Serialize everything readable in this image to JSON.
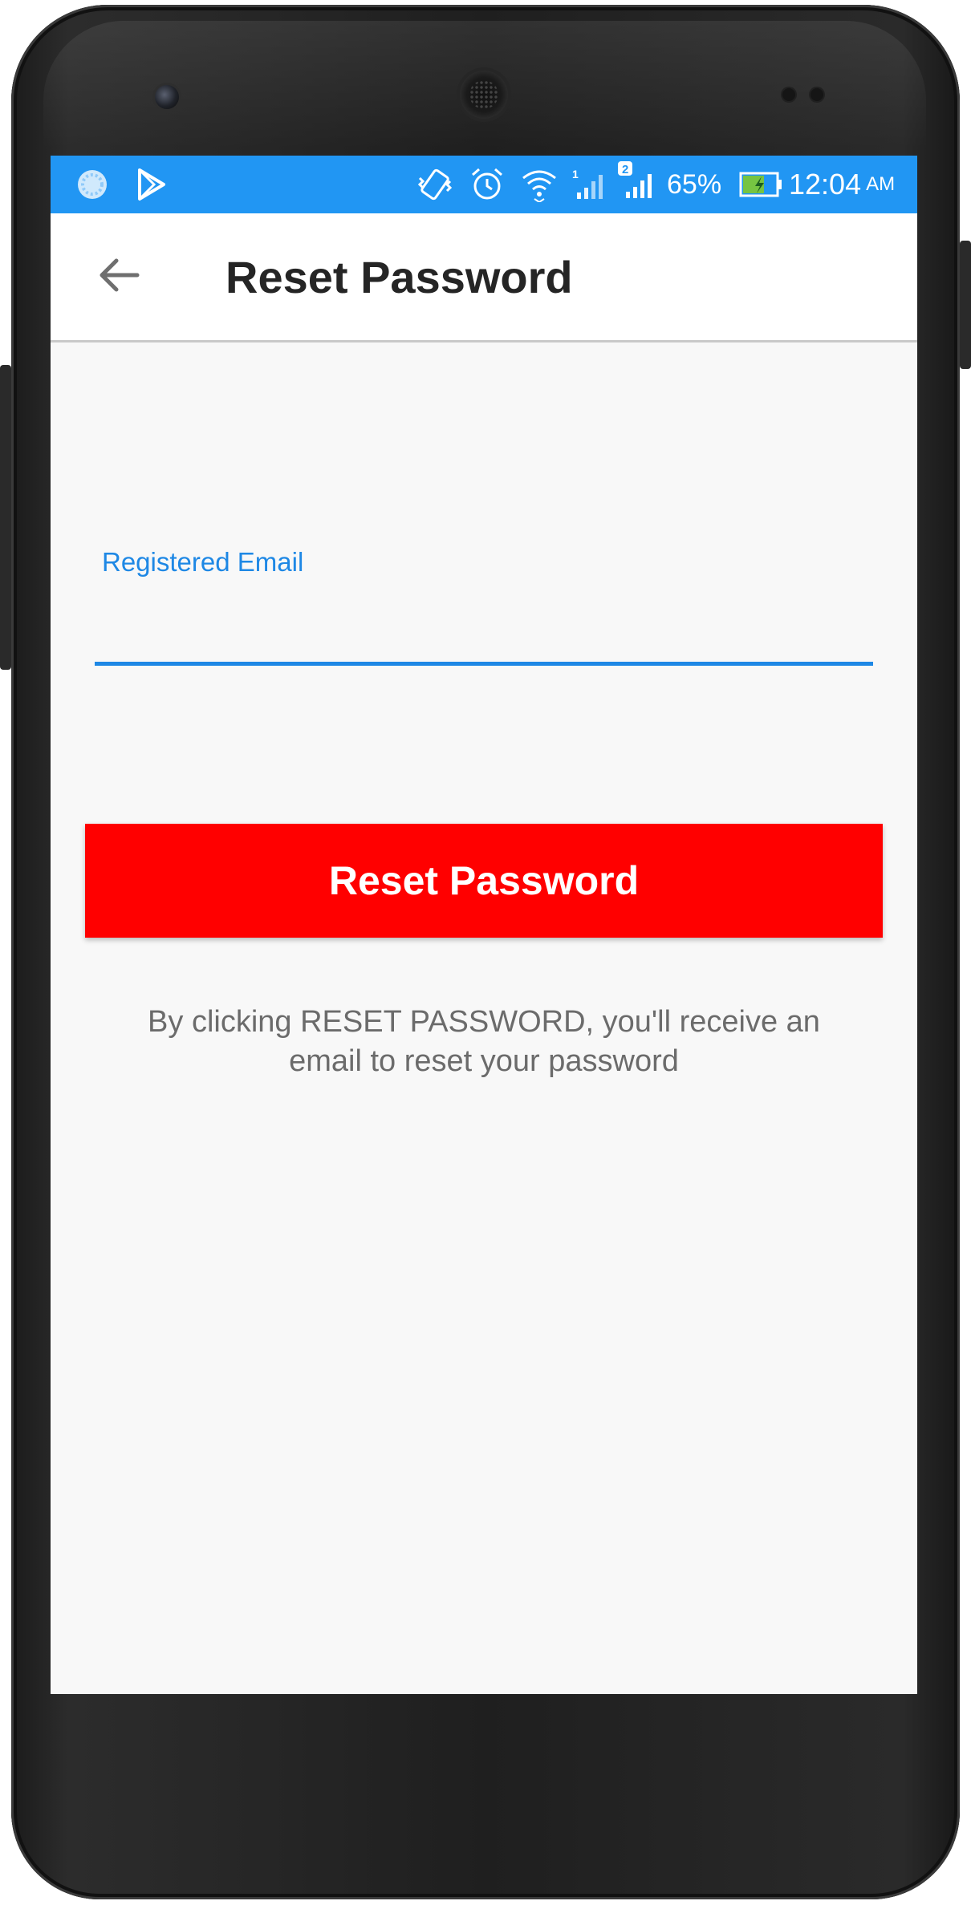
{
  "status_bar": {
    "battery_percent": "65%",
    "battery_level": 0.65,
    "time": "12:04",
    "ampm": "AM",
    "sim1_label": "1",
    "sim2_label": "2",
    "icons": [
      "loading-circle-icon",
      "play-store-icon",
      "vibrate-icon",
      "alarm-icon",
      "wifi-icon",
      "signal-sim1-icon",
      "signal-sim2-icon",
      "battery-charging-icon"
    ]
  },
  "app_bar": {
    "back_icon": "arrow-left-icon",
    "title": "Reset Password"
  },
  "form": {
    "email_label": "Registered Email",
    "email_value": "",
    "reset_button_label": "Reset Password",
    "helper_text": "By clicking RESET PASSWORD, you'll receive an email to reset your password"
  },
  "colors": {
    "status_bar": "#2196f3",
    "accent": "#1e88e5",
    "button": "#ff0000",
    "helper_text": "#6b6b6b",
    "battery_fill": "#76c442"
  }
}
